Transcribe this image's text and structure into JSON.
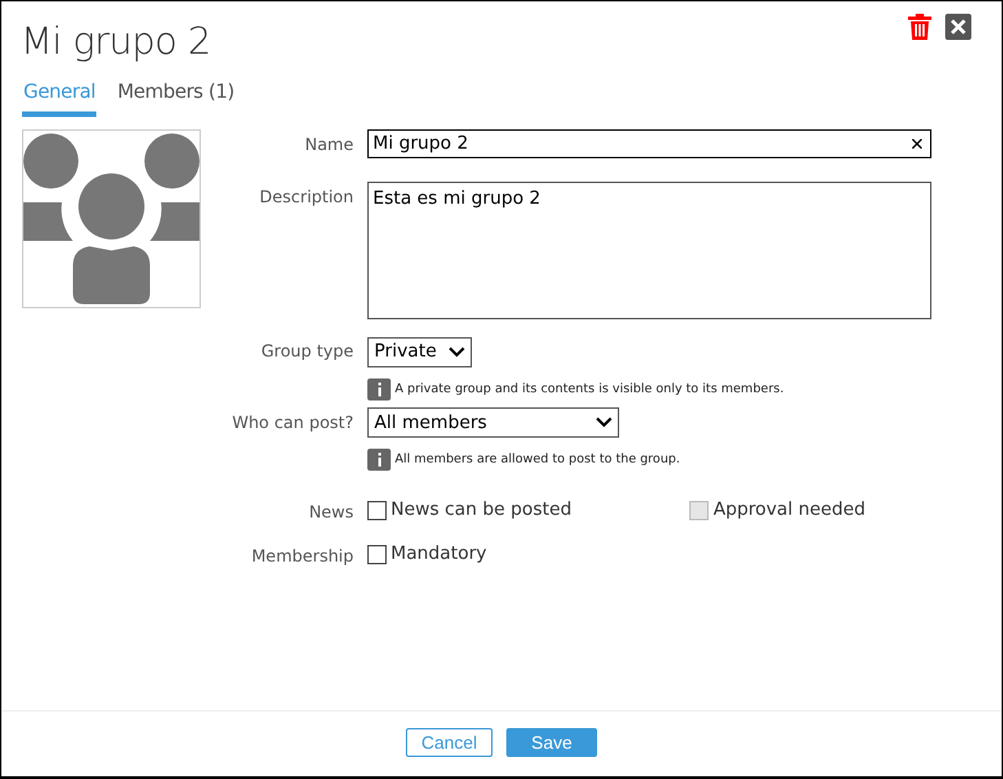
{
  "dialog": {
    "title": "Mi grupo 2"
  },
  "tabs": [
    {
      "label": "General",
      "selected": true
    },
    {
      "label": "Members (1)",
      "selected": false
    }
  ],
  "form": {
    "name": {
      "label": "Name",
      "value": "Mi grupo 2"
    },
    "description": {
      "label": "Description",
      "value": "Esta es mi grupo 2"
    },
    "group_type": {
      "label": "Group type",
      "value": "Private",
      "info": "A private group and its contents is visible only to its members."
    },
    "who_can_post": {
      "label": "Who can post?",
      "value": "All members",
      "info": "All members are allowed to post to the group."
    },
    "news": {
      "label": "News",
      "options": [
        {
          "label": "News can be posted",
          "checked": false,
          "disabled": false
        },
        {
          "label": "Approval needed",
          "checked": false,
          "disabled": true
        }
      ]
    },
    "membership": {
      "label": "Membership",
      "options": [
        {
          "label": "Mandatory",
          "checked": false,
          "disabled": false
        }
      ]
    }
  },
  "buttons": [
    {
      "label": "Cancel",
      "kind": "secondary"
    },
    {
      "label": "Save",
      "kind": "primary"
    }
  ]
}
